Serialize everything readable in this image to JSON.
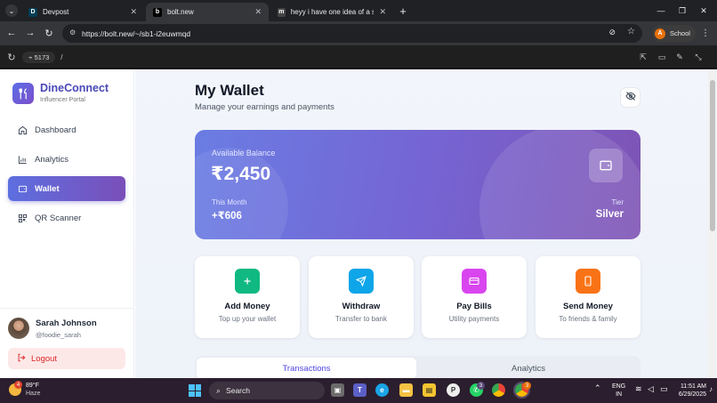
{
  "browser": {
    "tabs": [
      {
        "title": "Devpost",
        "favicon": "D"
      },
      {
        "title": "bolt.new",
        "favicon": "b"
      },
      {
        "title": "heyy i have one idea of a startu",
        "favicon": "m"
      }
    ],
    "url": "https://bolt.new/~/sb1-i2euwmqd",
    "profile_letter": "A",
    "profile_label": "School"
  },
  "devbar": {
    "port": "5173",
    "path": "/"
  },
  "sidebar": {
    "brand": "DineConnect",
    "brand_sub": "Influencer Portal",
    "items": [
      {
        "label": "Dashboard",
        "icon": "home-icon"
      },
      {
        "label": "Analytics",
        "icon": "bar-chart-icon"
      },
      {
        "label": "Wallet",
        "icon": "wallet-icon",
        "active": true
      },
      {
        "label": "QR Scanner",
        "icon": "qr-icon"
      }
    ],
    "user": {
      "name": "Sarah Johnson",
      "handle": "@foodie_sarah"
    },
    "logout": "Logout"
  },
  "main": {
    "title": "My Wallet",
    "subtitle": "Manage your earnings and payments",
    "balance": {
      "label": "Available Balance",
      "amount": "₹2,450",
      "month_label": "This Month",
      "month_amount": "+₹606",
      "tier_label": "Tier",
      "tier_value": "Silver"
    },
    "actions": [
      {
        "title": "Add Money",
        "sub": "Top up your wallet",
        "icon": "plus-icon",
        "color": "#10b981"
      },
      {
        "title": "Withdraw",
        "sub": "Transfer to bank",
        "icon": "send-icon",
        "color": "#0ea5e9"
      },
      {
        "title": "Pay Bills",
        "sub": "Utility payments",
        "icon": "credit-card-icon",
        "color": "#d946ef"
      },
      {
        "title": "Send Money",
        "sub": "To friends & family",
        "icon": "smartphone-icon",
        "color": "#f97316"
      }
    ],
    "tabs": [
      "Transactions",
      "Analytics"
    ]
  },
  "taskbar": {
    "weather_temp": "89°F",
    "weather_cond": "Haze",
    "weather_badge": "4",
    "search": "Search",
    "lang1": "ENG",
    "lang2": "IN",
    "time": "11:51 AM",
    "date": "6/29/2025",
    "badge_teams": "3",
    "badge_chrome": "3"
  }
}
